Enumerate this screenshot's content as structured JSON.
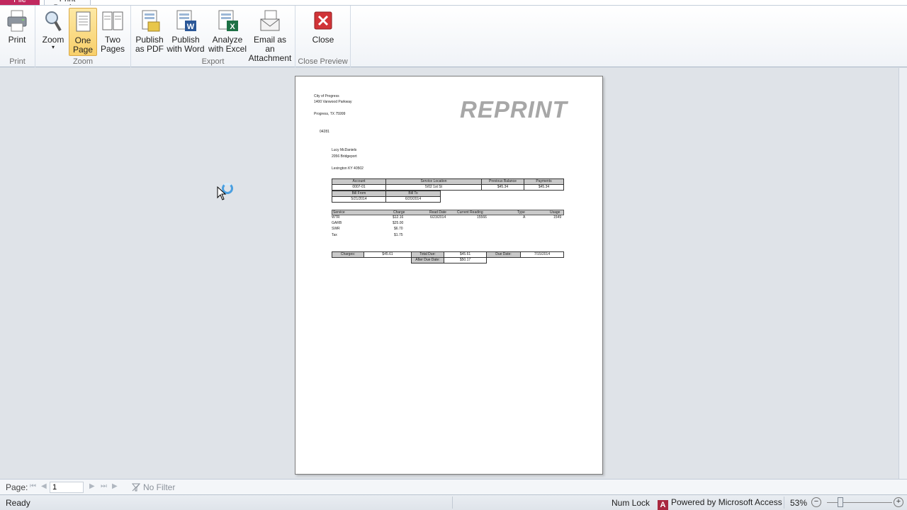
{
  "tabs": {
    "file": "File",
    "print_preview": "Print Preview"
  },
  "ribbon": {
    "groups": {
      "print": "Print",
      "zoom": "Zoom",
      "export": "Export",
      "close_preview": "Close Preview"
    },
    "buttons": {
      "print": "Print",
      "zoom": "Zoom",
      "one_page_1": "One",
      "one_page_2": "Page",
      "two_pages_1": "Two",
      "two_pages_2": "Pages",
      "pdf_1": "Publish",
      "pdf_2": "as PDF",
      "word_1": "Publish",
      "word_2": "with Word",
      "excel_1": "Analyze",
      "excel_2": "with Excel",
      "email_1": "Email as an",
      "email_2": "Attachment",
      "close": "Close"
    }
  },
  "report": {
    "sender": [
      "City of Progress",
      "1400 Vanwood Parkway",
      "Progress, TX  75999"
    ],
    "code": "04281",
    "watermark": "REPRINT",
    "recipient": [
      "Lucy McDaniels",
      "2056 Bridgeport",
      "Lexington KY 40502"
    ],
    "account_headers": [
      "Account",
      "Service Location",
      "Previous Balance",
      "Payments"
    ],
    "account_values": [
      "0007-01",
      "5/02 1st St",
      "$45.34",
      "$45.34"
    ],
    "bill_headers": [
      "Bill From",
      "Bill To"
    ],
    "bill_values": [
      "5/21/2014",
      "6/20/2014"
    ],
    "service_headers": [
      "Service",
      "Charge",
      "Read Date",
      "Current Reading",
      "Type",
      "Usage"
    ],
    "service_rows": [
      [
        "WTR",
        "$12.16",
        "6/23/2014",
        "15566",
        "A",
        "1549"
      ],
      [
        "GARB",
        "$25.00",
        "",
        "",
        "",
        ""
      ],
      [
        "SWR",
        "$6.70",
        "",
        "",
        "",
        ""
      ],
      [
        "Tax",
        "$1.75",
        "",
        "",
        "",
        ""
      ]
    ],
    "totals": {
      "charges_label": "Charges:",
      "charges": "$45.61",
      "total_due_label": "Total Due:",
      "total_due": "$45.61",
      "due_date_label": "Due Date:",
      "due_date": "7/15/2014",
      "after_due_label": "After Due Date:",
      "after_due": "$50.17"
    }
  },
  "navbar": {
    "page_label": "Page:",
    "page_value": "1",
    "filter": "No Filter"
  },
  "status": {
    "ready": "Ready",
    "num_lock": "Num Lock",
    "powered_by": "Powered by Microsoft Access",
    "zoom": "53%",
    "zoom_minus": "−",
    "zoom_plus": "+"
  },
  "colors": {
    "selected_button": "#f8cf6a",
    "close_red": "#d13438",
    "file_tab": "#c1285e"
  }
}
